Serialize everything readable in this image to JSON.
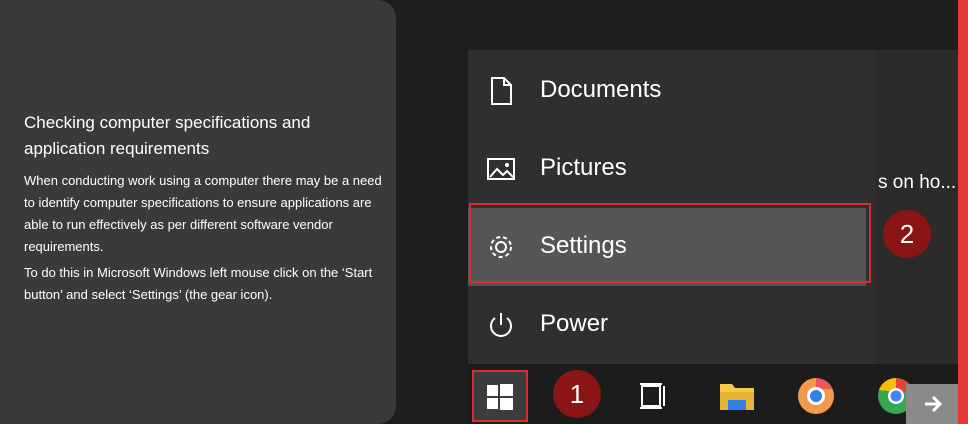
{
  "card": {
    "title": "Checking computer specifications and application requirements",
    "paragraph1": "When conducting work using a computer there may be a need to identify computer specifications to ensure applications are able to run effectively as per different software vendor requirements.",
    "paragraph2": "To do this in Microsoft Windows left mouse click on the ‘Start button’ and select ‘Settings’ (the gear icon)."
  },
  "start_menu": {
    "items": [
      {
        "label": "Documents",
        "icon": "document-icon"
      },
      {
        "label": "Pictures",
        "icon": "image-icon"
      },
      {
        "label": "Settings",
        "icon": "gear-icon"
      },
      {
        "label": "Power",
        "icon": "power-icon"
      }
    ]
  },
  "background_text": "s on ho...",
  "badges": {
    "step1": "1",
    "step2": "2"
  },
  "colors": {
    "highlight": "#d32f2f",
    "badge": "#8b1414",
    "accent_edge": "#e53935"
  }
}
